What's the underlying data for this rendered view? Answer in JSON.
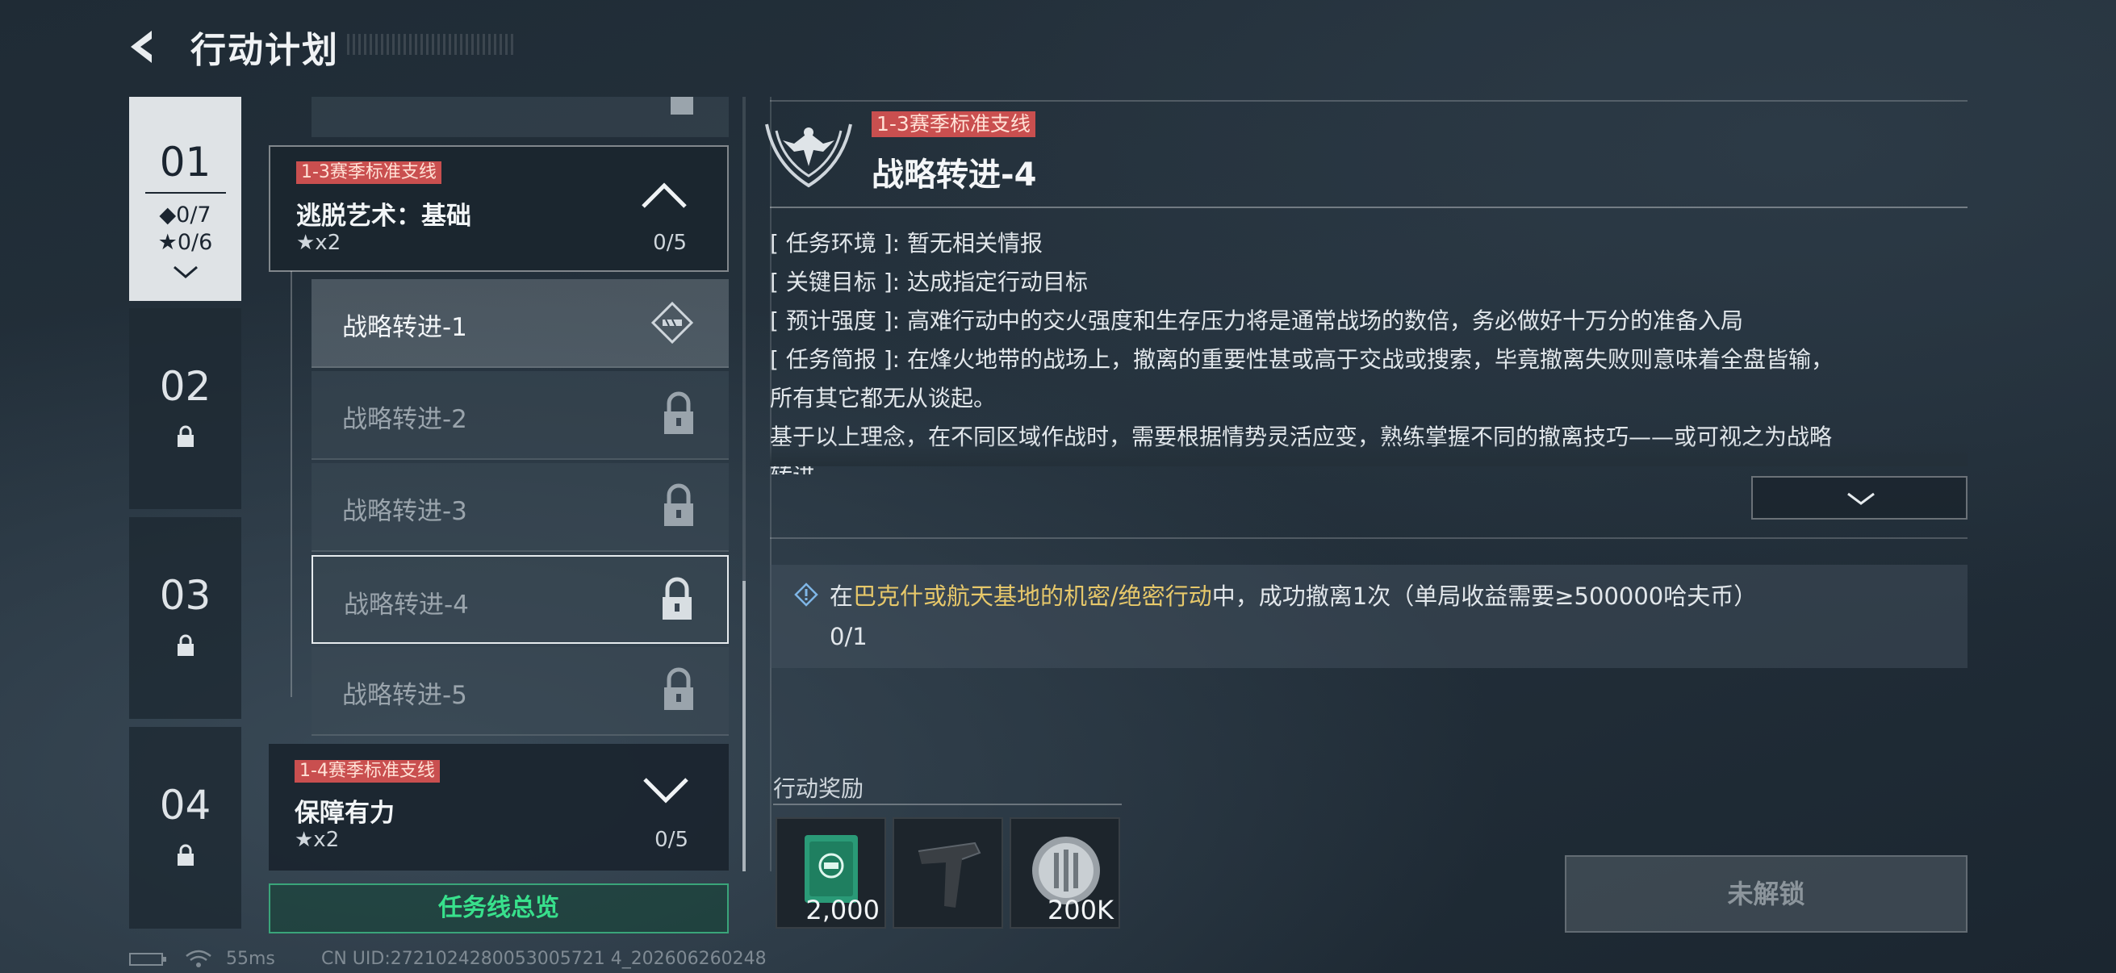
{
  "header": {
    "title": "行动计划"
  },
  "chapters": [
    {
      "num": "01",
      "diamonds": "◆0/7",
      "stars": "★0/6",
      "active": true
    },
    {
      "num": "02",
      "locked": true
    },
    {
      "num": "03",
      "locked": true
    },
    {
      "num": "04",
      "locked": true
    }
  ],
  "groups": [
    {
      "tag": "1-3赛季标准支线",
      "title": "逃脱艺术：基础",
      "stars": "★x2",
      "count": "0/5",
      "expanded": true
    },
    {
      "tag": "1-4赛季标准支线",
      "title": "保障有力",
      "stars": "★x2",
      "count": "0/5",
      "expanded": false
    }
  ],
  "missions": [
    {
      "label": "战略转进-1",
      "state": "current"
    },
    {
      "label": "战略转进-2",
      "state": "locked"
    },
    {
      "label": "战略转进-3",
      "state": "locked"
    },
    {
      "label": "战略转进-4",
      "state": "locked-selected"
    },
    {
      "label": "战略转进-5",
      "state": "locked"
    }
  ],
  "overview_button": "任务线总览",
  "detail": {
    "tag": "1-3赛季标准支线",
    "title": "战略转进-4",
    "rows": [
      {
        "key": "[ 任务环境 ]",
        "value": "暂无相关情报"
      },
      {
        "key": "[ 关键目标 ]",
        "value": "达成指定行动目标"
      },
      {
        "key": "[ 预计强度 ]",
        "value": "高难行动中的交火强度和生存压力将是通常战场的数倍，务必做好十万分的准备入局"
      },
      {
        "key": "[ 任务简报 ]",
        "value": "在烽火地带的战场上，撤离的重要性甚或高于交战或搜索，毕竟撤离失败则意味着全盘皆输，"
      }
    ],
    "line5": "所有其它都无从谈起。",
    "line6": "基于以上理念，在不同区域作战时，需要根据情势灵活应变，熟练掌握不同的撤离技巧——或可视之为战略",
    "line7": "转进。"
  },
  "objective": {
    "prefix": "在",
    "highlight": "巴克什或航天基地的机密/绝密行动",
    "suffix": "中，成功撤离1次（单局收益需要≥500000哈夫币）",
    "progress": "0/1"
  },
  "rewards": {
    "label": "行动奖励",
    "items": [
      {
        "icon": "green-card-icon",
        "qty": "2,000"
      },
      {
        "icon": "grip-icon",
        "qty": ""
      },
      {
        "icon": "coin-icon",
        "qty": "200K"
      }
    ]
  },
  "unlock_button": "未解锁",
  "status": {
    "ping": "55ms",
    "uid": "CN UID:2721024280053005721 4_202606260248"
  },
  "colors": {
    "accent_green": "#38e08c",
    "tag_red": "#c94f4f",
    "highlight_gold": "#e7c86a"
  }
}
